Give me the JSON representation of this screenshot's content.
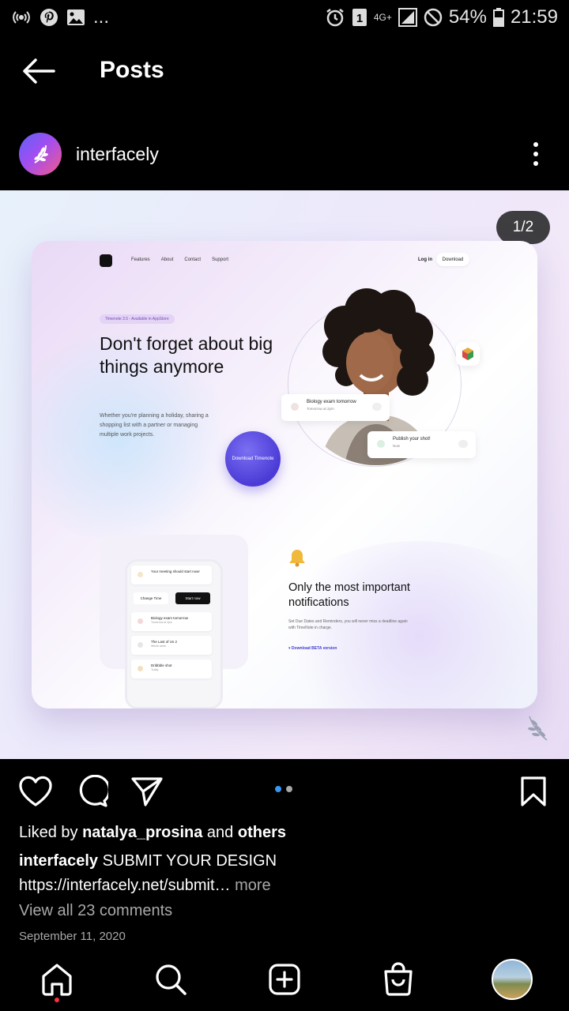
{
  "status_bar": {
    "battery": "54%",
    "time": "21:59",
    "network": "4G+",
    "sim": "1",
    "more": "..."
  },
  "app_bar": {
    "title": "Posts"
  },
  "post": {
    "username": "interfacely",
    "media_counter": "1/2",
    "media": {
      "nav": [
        "Features",
        "About",
        "Contact",
        "Support"
      ],
      "login": "Log in",
      "download": "Download",
      "badge": "Timenote 3.5 - Available in AppStore",
      "headline": "Don't forget about big things anymore",
      "paragraph": "Whether you're planning a holiday, sharing a shopping list with a partner or managing multiple work projects.",
      "cta": "Download Timenote",
      "notif1_title": "Biology exam tomorrow",
      "notif1_sub": "Tomorrow at 2pm",
      "notif2_title": "Publish your shot!",
      "notif2_sub": "Now",
      "phone_row1_title": "Your meeting should start now!",
      "phone_btn_change": "Change Time",
      "phone_btn_start": "Start now",
      "phone_row2_title": "Biology exam tomorrow",
      "phone_row2_sub": "Tomorrow at 2pm",
      "phone_row3_title": "The Last of Us 2",
      "phone_row3_sub": "Whole week",
      "phone_row4_title": "Dribbble shot",
      "phone_row4_sub": "Today",
      "section_title": "Only the most important notifications",
      "section_text": "Set Due Dates and Reminders, you will never miss a deadline again with TimeNote in charge.",
      "section_link": "Download BETA version"
    },
    "likes": {
      "prefix": "Liked by",
      "user": "natalya_prosina",
      "and": "and",
      "others": "others"
    },
    "caption": {
      "user": "interfacely",
      "text": "SUBMIT YOUR DESIGN",
      "link": "https://interfacely.net/submit…",
      "more": "more"
    },
    "comments_link": "View all 23 comments",
    "date": "September 11, 2020",
    "carousel": {
      "count": 2,
      "active": 0
    }
  },
  "colors": {
    "accent_blue": "#3897f0",
    "inactive_dot": "#a8a8a8",
    "secondary_text": "#a8a8a8",
    "notification_red": "#ff3040"
  },
  "bottom_nav": [
    "home-icon",
    "search-icon",
    "new-post-icon",
    "shop-icon",
    "profile-avatar"
  ]
}
